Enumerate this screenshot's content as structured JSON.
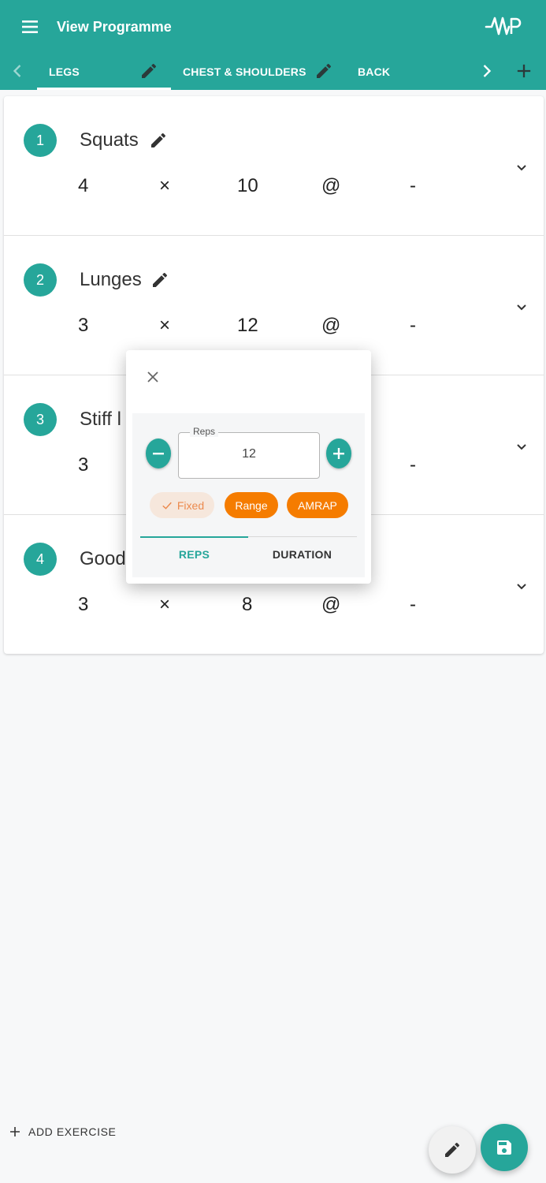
{
  "colors": {
    "primary": "#26a69a",
    "accent": "#f57c00",
    "background": "#f7f8f9"
  },
  "header": {
    "title": "View Programme",
    "menu_icon": "hamburger-menu-icon",
    "logo_text": "WP",
    "tabs": [
      {
        "label": "LEGS",
        "selected": true
      },
      {
        "label": "CHEST & SHOULDERS",
        "selected": false
      },
      {
        "label": "BACK",
        "selected": false
      }
    ]
  },
  "exercises": [
    {
      "number": "1",
      "name": "Squats",
      "sets": "4",
      "times": "×",
      "reps": "10",
      "at": "@",
      "weight": "-"
    },
    {
      "number": "2",
      "name": "Lunges",
      "sets": "3",
      "times": "×",
      "reps": "12",
      "at": "@",
      "weight": "-"
    },
    {
      "number": "3",
      "name": "Stiff l",
      "sets": "3",
      "times": "",
      "reps": "",
      "at": "",
      "weight": "-"
    },
    {
      "number": "4",
      "name": "Good",
      "sets": "3",
      "times": "×",
      "reps": "8",
      "at": "@",
      "weight": "-"
    }
  ],
  "popup": {
    "reps_legend": "Reps",
    "reps_value": "12",
    "chips": {
      "fixed": "Fixed",
      "range": "Range",
      "amrap": "AMRAP"
    },
    "selected_chip": "Fixed",
    "tabs": {
      "reps": "REPS",
      "duration": "DURATION"
    },
    "selected_tab": "REPS"
  },
  "footer": {
    "add_exercise": "ADD EXERCISE"
  }
}
